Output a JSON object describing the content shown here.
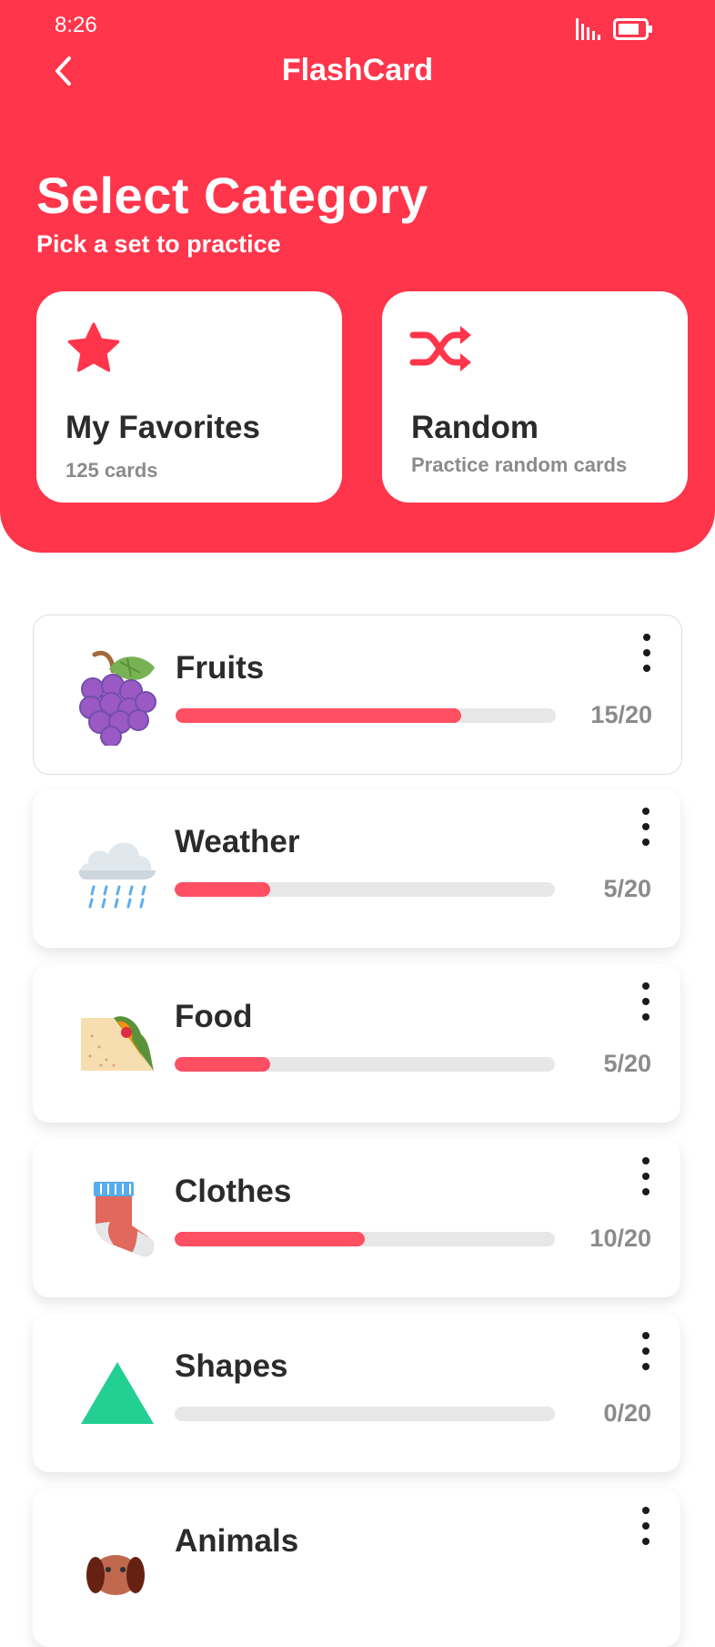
{
  "status": {
    "time": "8:26"
  },
  "app": {
    "title": "FlashCard"
  },
  "page": {
    "title": "Select Category",
    "subtitle": "Pick a set to practice"
  },
  "quick": {
    "favorites": {
      "title": "My Favorites",
      "subtitle": "125 cards",
      "icon": "star-icon"
    },
    "random": {
      "title": "Random",
      "subtitle": "Practice random cards",
      "icon": "shuffle-icon"
    }
  },
  "categories": [
    {
      "name": "Fruits",
      "count": "15/20",
      "progress": 0.75,
      "icon": "grapes-icon"
    },
    {
      "name": "Weather",
      "count": "5/20",
      "progress": 0.25,
      "icon": "rain-cloud-icon"
    },
    {
      "name": "Food",
      "count": "5/20",
      "progress": 0.25,
      "icon": "sandwich-wrap-icon"
    },
    {
      "name": "Clothes",
      "count": "10/20",
      "progress": 0.5,
      "icon": "sock-icon"
    },
    {
      "name": "Shapes",
      "count": "0/20",
      "progress": 0.0,
      "icon": "triangle-icon"
    },
    {
      "name": "Animals",
      "count": "",
      "progress": null,
      "icon": "dog-icon"
    }
  ],
  "colors": {
    "accent": "#ff354b",
    "progress": "#fe4f63",
    "track": "#e7e7e7"
  }
}
